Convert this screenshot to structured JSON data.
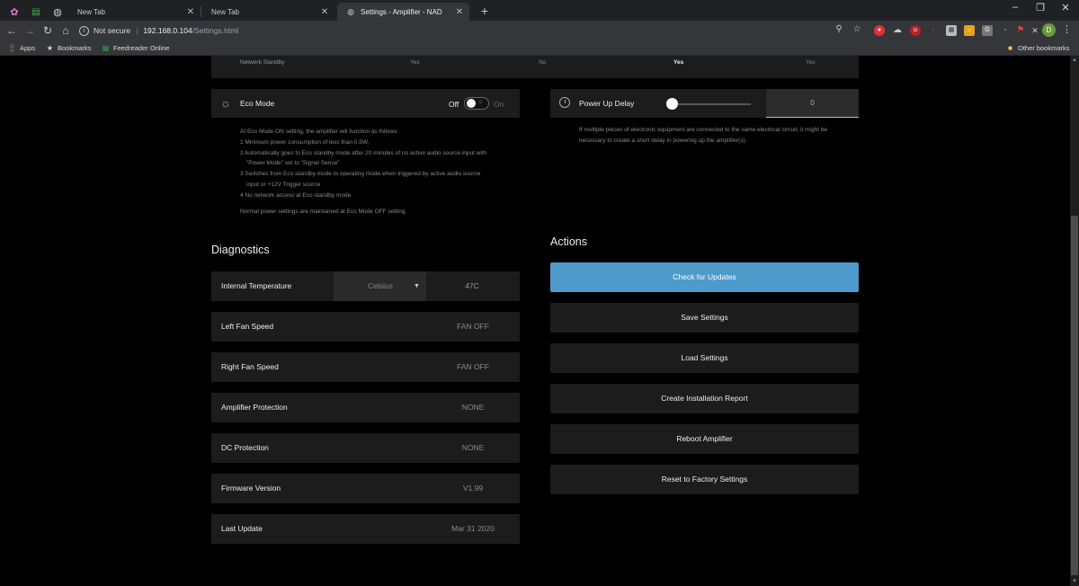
{
  "browser": {
    "tabs": [
      {
        "title": "New Tab",
        "active": false
      },
      {
        "title": "New Tab",
        "active": false
      },
      {
        "title": "Settings - Amplifier - NAD",
        "active": true
      }
    ],
    "new_tab_symbol": "+",
    "address": {
      "security_label": "Not secure",
      "host": "192.168.0.104",
      "path": "/Settings.html"
    },
    "bookmarks": [
      {
        "label": "Apps",
        "icon": "apps-grid-icon"
      },
      {
        "label": "Bookmarks",
        "icon": "star-icon"
      },
      {
        "label": "Feedreader Online",
        "icon": "feedreader-icon"
      }
    ],
    "other_bookmarks": "Other bookmarks",
    "profile_initial": "D"
  },
  "network_standby": {
    "label": "Network Standby",
    "values": [
      "Yes",
      "No",
      "Yes",
      "Yes"
    ]
  },
  "eco_mode": {
    "title": "Eco Mode",
    "off_label": "Off",
    "on_label": "On",
    "toggle_small": "o",
    "state": "off",
    "description": [
      "At Eco Mode ON setting, the amplifier will function as follows:",
      "1 Minimum power consumption of less than 0.5W,",
      "2 Automatically goes to Eco standby mode after 20 minutes of no active audio source input with",
      "\"Power Mode\" set to \"Signal Sense\"",
      "3 Switches from Eco standby mode to operating mode when triggered by active audio source",
      "input or +12V Trigger source",
      "4 No network access at Eco standby mode"
    ],
    "note": "Normal power settings are maintained at Eco Mode OFF setting."
  },
  "power_up_delay": {
    "title": "Power Up Delay",
    "value": "0",
    "slider_fraction": 0,
    "description": [
      "If multiple pieces of electronic equipment are connected to the same electrical circuit, it might be",
      "necessary to create a short delay in powering up the amplifier(s)."
    ]
  },
  "diagnostics": {
    "heading": "Diagnostics",
    "temperature": {
      "label": "Internal Temperature",
      "unit": "Celsius",
      "value": "47C"
    },
    "rows": [
      {
        "label": "Left Fan Speed",
        "value": "FAN OFF"
      },
      {
        "label": "Right Fan Speed",
        "value": "FAN OFF"
      },
      {
        "label": "Amplifier Protection",
        "value": "NONE"
      },
      {
        "label": "DC Protection",
        "value": "NONE"
      },
      {
        "label": "Firmware Version",
        "value": "V1.99"
      },
      {
        "label": "Last Update",
        "value": "Mar 31 2020"
      }
    ]
  },
  "actions": {
    "heading": "Actions",
    "buttons": [
      {
        "label": "Check for Updates",
        "primary": true
      },
      {
        "label": "Save Settings",
        "primary": false
      },
      {
        "label": "Load Settings",
        "primary": false
      },
      {
        "label": "Create Installation Report",
        "primary": false
      },
      {
        "label": "Reboot Amplifier",
        "primary": false
      },
      {
        "label": "Reset to Factory Settings",
        "primary": false
      }
    ]
  },
  "colors": {
    "accent": "#4e9acb",
    "panel": "#1c1c1c",
    "background": "#000000"
  }
}
